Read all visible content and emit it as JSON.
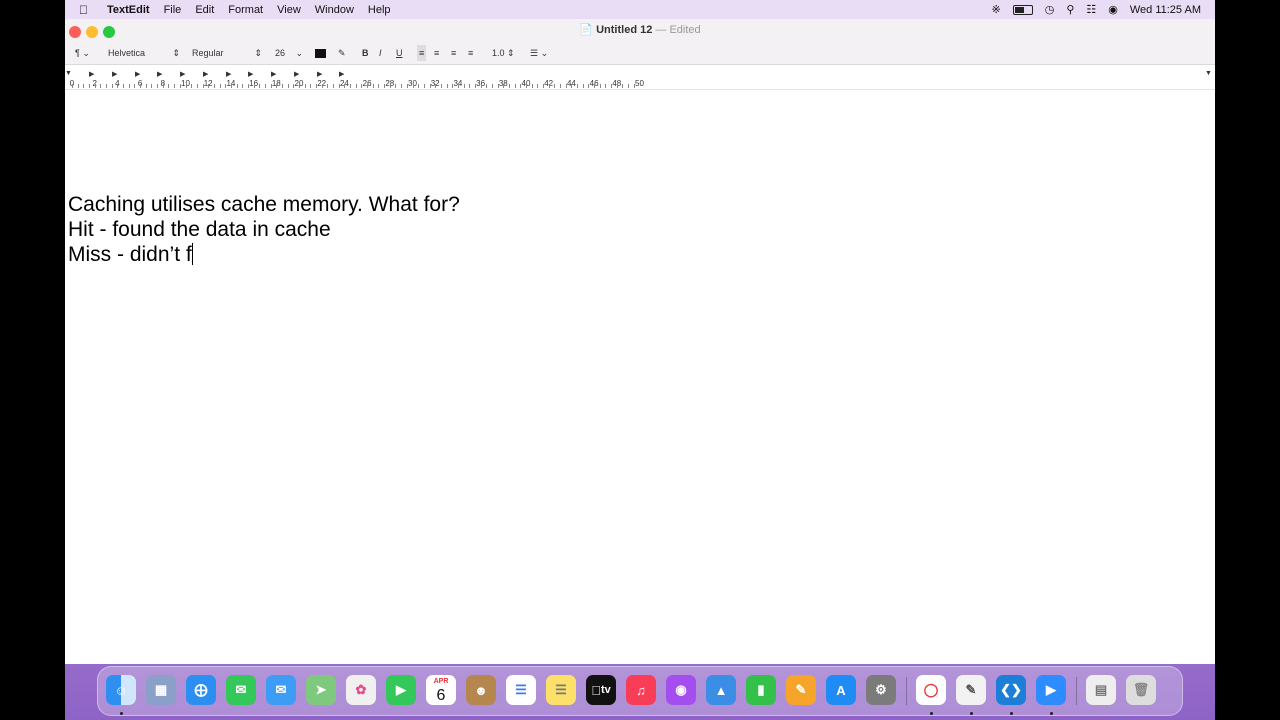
{
  "menubar": {
    "app_name": "TextEdit",
    "menus": [
      "File",
      "Edit",
      "Format",
      "View",
      "Window",
      "Help"
    ],
    "clock": "Wed 11:25 AM"
  },
  "window": {
    "title": "Untitled 12",
    "separator": "—",
    "status": "Edited"
  },
  "toolbar": {
    "paragraph_glyph": "¶",
    "font_family": "Helvetica",
    "font_style": "Regular",
    "font_size": "26",
    "bold": "B",
    "italic": "I",
    "underline": "U",
    "line_spacing": "1.0"
  },
  "ruler": {
    "labels": [
      "0",
      "2",
      "4",
      "6",
      "8",
      "10",
      "12",
      "14",
      "16",
      "18",
      "20",
      "22",
      "24",
      "26",
      "28",
      "30",
      "32",
      "34",
      "36",
      "38",
      "40",
      "42",
      "44",
      "46",
      "48",
      "50"
    ]
  },
  "document": {
    "lines": [
      "Caching utilises cache memory. What for?",
      "Hit - found the data in cache",
      "Miss - didn’t f"
    ]
  },
  "dock": {
    "calendar_month": "APR",
    "calendar_day": "6",
    "tv_label": "tv",
    "items": [
      "finder-icon",
      "launchpad-icon",
      "safari-icon",
      "messages-icon",
      "mail-icon",
      "maps-icon",
      "photos-icon",
      "facetime-icon",
      "calendar-icon",
      "contacts-icon",
      "reminders-icon",
      "notes-icon",
      "apple-tv-icon",
      "music-icon",
      "podcasts-icon",
      "keynote-icon",
      "numbers-icon",
      "pages-icon",
      "app-store-icon",
      "system-preferences-icon",
      "chrome-icon",
      "textedit-icon",
      "vscode-icon",
      "zoom-icon",
      "documents-icon",
      "trash-icon"
    ]
  },
  "colors": {
    "close": "#fe5f57",
    "minimize": "#febc2e",
    "maximize": "#28c840"
  }
}
